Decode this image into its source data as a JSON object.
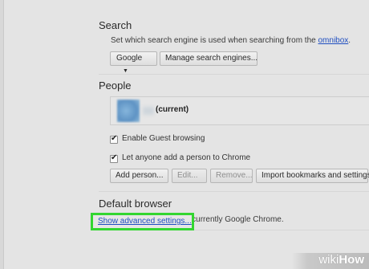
{
  "search": {
    "title": "Search",
    "description": "Set which search engine is used when searching from the ",
    "omnibox_link": "omnibox",
    "description_end": ".",
    "engine_selected": "Google",
    "manage_button": "Manage search engines..."
  },
  "people": {
    "title": "People",
    "current_profile_label": "(current)",
    "guest_browsing_label": "Enable Guest browsing",
    "guest_browsing_checked": true,
    "add_person_label": "Let anyone add a person to Chrome",
    "add_person_checked": true,
    "buttons": {
      "add_person": "Add person...",
      "edit": "Edit...",
      "remove": "Remove...",
      "import": "Import bookmarks and settings..."
    }
  },
  "default_browser": {
    "title": "Default browser",
    "status": "The default browser is currently Google Chrome."
  },
  "advanced": {
    "link_label": "Show advanced settings..."
  },
  "watermark": {
    "part1": "wiki",
    "part2": "How"
  },
  "colors": {
    "background": "#e4e4e4",
    "link": "#1f4ec0",
    "highlight": "#33d631"
  }
}
